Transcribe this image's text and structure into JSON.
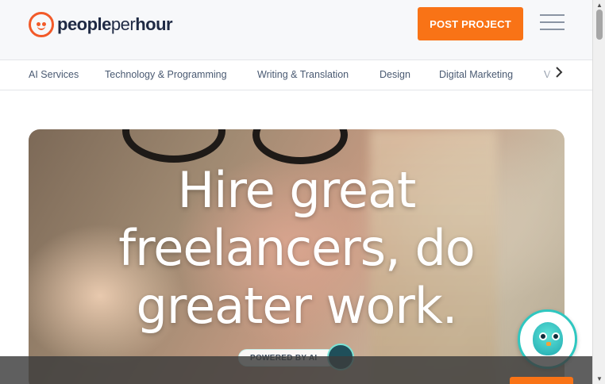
{
  "header": {
    "logo": {
      "brand_bold": "people",
      "brand_mid": "per",
      "brand_end": "hour"
    },
    "post_project_label": "POST PROJECT",
    "menu_icon": "hamburger-icon"
  },
  "categories": {
    "items": [
      {
        "label": "AI Services"
      },
      {
        "label": "Technology & Programming"
      },
      {
        "label": "Writing & Translation"
      },
      {
        "label": "Design"
      },
      {
        "label": "Digital Marketing"
      },
      {
        "label": "V"
      }
    ],
    "next_icon": "chevron-right-icon"
  },
  "hero": {
    "title_line1": "Hire great",
    "title_line2": "freelancers, do",
    "title_line3": "greater work.",
    "badge": "POWERED BY AI"
  },
  "chatbot": {
    "icon": "bird-avatar-icon"
  },
  "colors": {
    "accent": "#f97316",
    "brand": "#f25a29",
    "teal": "#2fc7c0"
  }
}
